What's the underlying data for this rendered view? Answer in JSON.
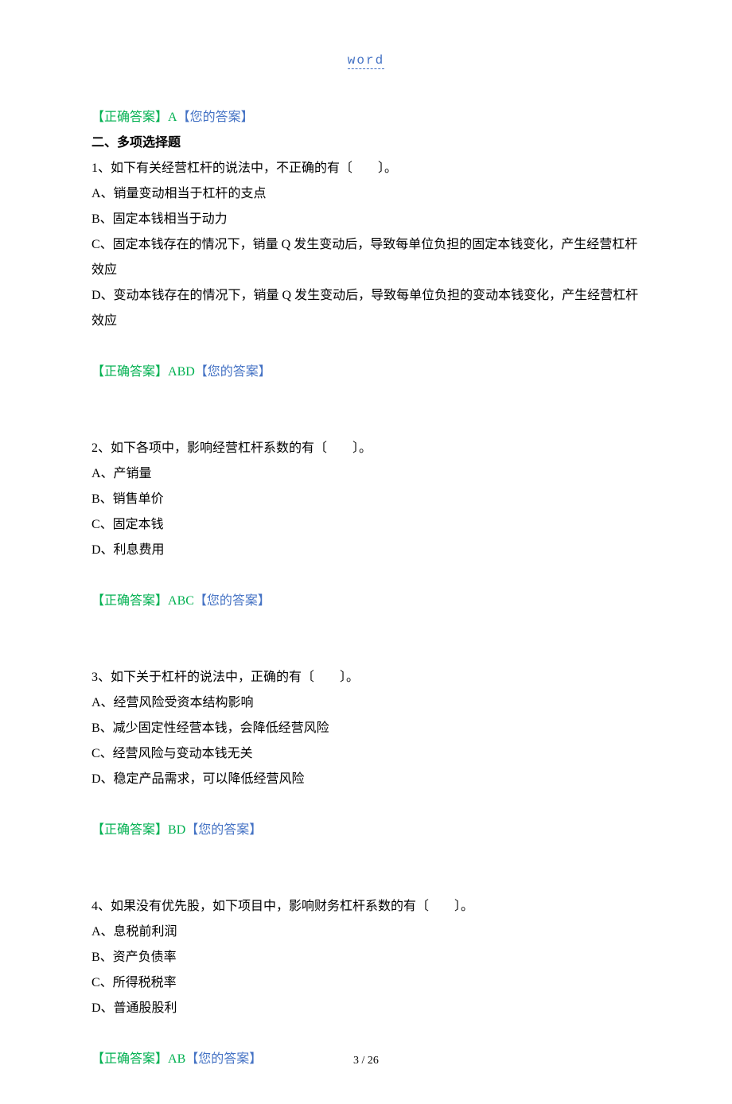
{
  "header": "word",
  "answer_prev": {
    "correct_label": "【正确答案】",
    "correct_value": "A",
    "your_label": "【您的答案】"
  },
  "section_title": "二、多项选择题",
  "questions": [
    {
      "stem": "1、如下有关经营杠杆的说法中，不正确的有〔　　〕。",
      "options": [
        "A、销量变动相当于杠杆的支点",
        "B、固定本钱相当于动力",
        "C、固定本钱存在的情况下，销量 Q 发生变动后，导致每单位负担的固定本钱变化，产生经营杠杆效应",
        "D、变动本钱存在的情况下，销量 Q 发生变动后，导致每单位负担的变动本钱变化，产生经营杠杆效应"
      ],
      "correct_label": "【正确答案】",
      "correct_value": "ABD",
      "your_label": "【您的答案】"
    },
    {
      "stem": "2、如下各项中，影响经营杠杆系数的有〔　　〕。",
      "options": [
        "A、产销量",
        "B、销售单价",
        "C、固定本钱",
        "D、利息费用"
      ],
      "correct_label": "【正确答案】",
      "correct_value": "ABC",
      "your_label": "【您的答案】"
    },
    {
      "stem": "3、如下关于杠杆的说法中，正确的有〔　　〕。",
      "options": [
        "A、经营风险受资本结构影响",
        "B、减少固定性经营本钱，会降低经营风险",
        "C、经营风险与变动本钱无关",
        "D、稳定产品需求，可以降低经营风险"
      ],
      "correct_label": "【正确答案】",
      "correct_value": "BD",
      "your_label": "【您的答案】"
    },
    {
      "stem": "4、如果没有优先股，如下项目中，影响财务杠杆系数的有〔　　〕。",
      "options": [
        "A、息税前利润",
        "B、资产负债率",
        "C、所得税税率",
        "D、普通股股利"
      ],
      "correct_label": "【正确答案】",
      "correct_value": "AB",
      "your_label": "【您的答案】"
    }
  ],
  "footer": "3 / 26"
}
